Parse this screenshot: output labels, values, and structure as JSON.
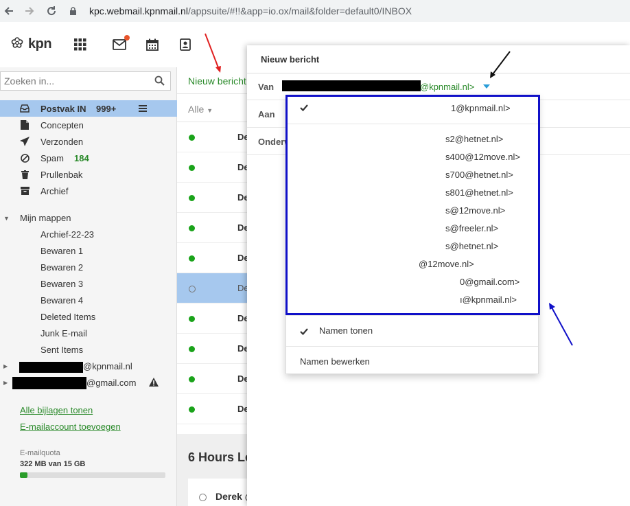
{
  "browser": {
    "url_host": "kpc.webmail.kpnmail.nl",
    "url_path": "/appsuite/#!!&app=io.ox/mail&folder=default0/INBOX"
  },
  "header": {
    "logo_text": "kpn",
    "icons": [
      "apps-grid-icon",
      "mail-icon",
      "calendar-icon",
      "contacts-icon"
    ]
  },
  "sidebar": {
    "search_placeholder": "Zoeken in...",
    "folders": [
      {
        "label": "Postvak IN",
        "count": "999+"
      },
      {
        "label": "Concepten"
      },
      {
        "label": "Verzonden"
      },
      {
        "label": "Spam",
        "count": "184"
      },
      {
        "label": "Prullenbak"
      },
      {
        "label": "Archief"
      }
    ],
    "my_folders_label": "Mijn mappen",
    "sub_folders": [
      "Archief-22-23",
      "Bewaren 1",
      "Bewaren 2",
      "Bewaren 3",
      "Bewaren 4",
      "Deleted Items",
      "Junk E-mail",
      "Sent Items"
    ],
    "accounts": [
      {
        "suffix": "@kpnmail.nl"
      },
      {
        "suffix": "@gmail.com"
      }
    ],
    "links": [
      "Alle bijlagen tonen",
      "E-mailaccount toevoegen"
    ],
    "quota": {
      "label": "E-mailquota",
      "value": "322 MB van 15 GB",
      "fraction": 0.05
    }
  },
  "message_list": {
    "new_message_label": "Nieuw bericht",
    "sort_label": "Alle",
    "rows": [
      {
        "text": "De",
        "unread": true
      },
      {
        "text": "De",
        "unread": true
      },
      {
        "text": "De",
        "unread": true
      },
      {
        "text": "De",
        "unread": true
      },
      {
        "text": "De",
        "unread": true
      },
      {
        "text": "De",
        "unread": false,
        "selected": true
      },
      {
        "text": "De",
        "unread": true
      },
      {
        "text": "De",
        "unread": true
      },
      {
        "text": "De",
        "unread": true
      },
      {
        "text": "De",
        "unread": true
      }
    ],
    "section_label": "6 Hours Le",
    "bottom_sender": "Derek @"
  },
  "compose": {
    "title": "Nieuw bericht",
    "from_label": "Van",
    "from_value": "@kpnmail.nl>",
    "to_label": "Aan",
    "subject_label": "Onderw"
  },
  "dropdown": {
    "selected": "1@kpnmail.nl>",
    "addresses": [
      "s2@hetnet.nl>",
      "s400@12move.nl>",
      "s700@hetnet.nl>",
      "s801@hetnet.nl>",
      "s@12move.nl>",
      "s@freeler.nl>",
      "s@hetnet.nl>",
      "@12move.nl>",
      "0@gmail.com>",
      "ı@kpnmail.nl>"
    ],
    "show_names": "Namen tonen",
    "edit_names": "Namen bewerken"
  },
  "colors": {
    "accent_green": "#2a8a2a",
    "selection_blue": "#a6c8ee",
    "annotation_box": "#1010c8",
    "annotation_red_arrow": "#e02020",
    "annotation_blue_arrow": "#1010c8"
  }
}
